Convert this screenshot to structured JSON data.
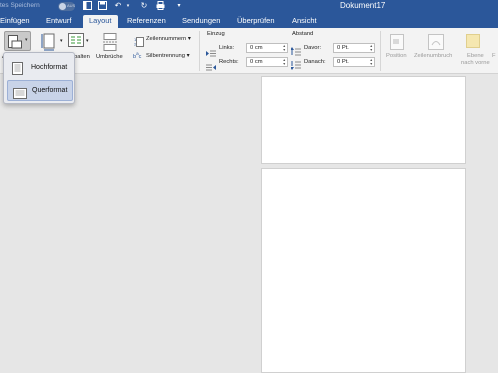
{
  "titlebar": {
    "autosave_label": "tes Speichern",
    "toggle_state": "AUS",
    "document_title": "Dokument17",
    "background": "#2b579a"
  },
  "tabs": [
    {
      "label": "Einfügen",
      "active": false
    },
    {
      "label": "Entwurf",
      "active": false
    },
    {
      "label": "Layout",
      "active": true
    },
    {
      "label": "Referenzen",
      "active": false
    },
    {
      "label": "Sendungen",
      "active": false
    },
    {
      "label": "Überprüfen",
      "active": false
    },
    {
      "label": "Ansicht",
      "active": false
    }
  ],
  "ribbon": {
    "spalten_label": "palten",
    "umbrueche_label": "Umbrüche",
    "zeilennummern_label": "Zeilennummern",
    "silbentrennung_label": "Silbentrennung",
    "einzug": {
      "group_label": "Einzug",
      "links_label": "Links:",
      "links_value": "0 cm",
      "rechts_label": "Rechts:",
      "rechts_value": "0 cm"
    },
    "abstand": {
      "group_label": "Abstand",
      "davor_label": "Davor:",
      "davor_value": "0 Pt.",
      "danach_label": "Danach:",
      "danach_value": "0 Pt."
    },
    "position_label": "Position",
    "zeilenumbruch_label": "Zeilenumbruch",
    "ebene_nach_vorne_line1": "Ebene",
    "ebene_nach_vorne_line2": "nach vorne",
    "orientation_partial_label": "A"
  },
  "orientation_menu": {
    "items": [
      {
        "label": "Hochformat",
        "selected": false
      },
      {
        "label": "Querformat",
        "selected": true
      }
    ]
  },
  "colors": {
    "accent": "#2b579a",
    "ribbon_bg": "#f3f3f3",
    "canvas_bg": "#e6e6e6"
  }
}
